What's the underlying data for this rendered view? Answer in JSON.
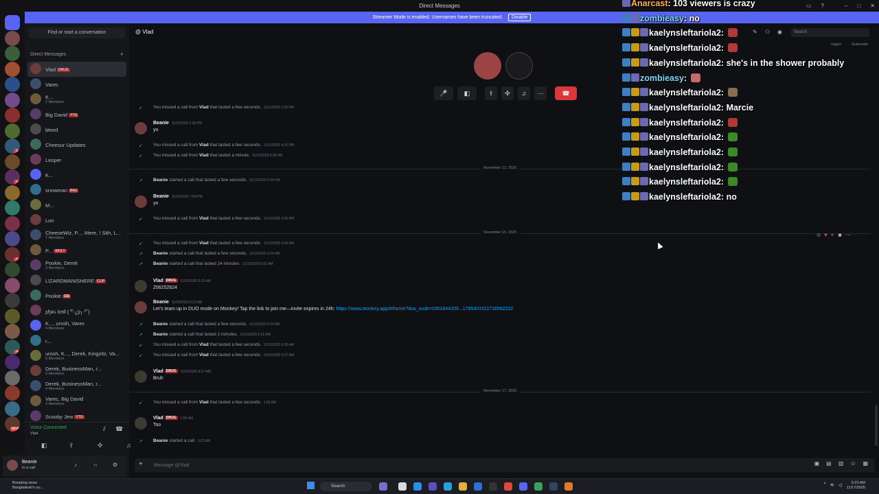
{
  "window": {
    "title": "Direct Messages"
  },
  "banner": {
    "text": "Streamer Mode is enabled. Usernames have been truncated.",
    "disable_label": "Disable"
  },
  "sidebar": {
    "search_label": "Find or start a conversation",
    "dm_header": "Direct Messages",
    "items": [
      {
        "name": "Vlad",
        "tag": "DRUG",
        "sub": ""
      },
      {
        "name": "Varec",
        "tag": "",
        "sub": ""
      },
      {
        "name": "K...",
        "tag": "",
        "sub": "2 Members"
      },
      {
        "name": "Big David",
        "tag": "YTG",
        "sub": ""
      },
      {
        "name": "bleed",
        "tag": "",
        "sub": ""
      },
      {
        "name": "Cheesur Updates",
        "tag": "",
        "sub": ""
      },
      {
        "name": "Leoper",
        "tag": "",
        "sub": ""
      },
      {
        "name": "K...",
        "tag": "",
        "sub": ""
      },
      {
        "name": "snowman",
        "tag": "BAU",
        "sub": ""
      },
      {
        "name": "M...",
        "tag": "",
        "sub": ""
      },
      {
        "name": "Lon",
        "tag": "",
        "sub": ""
      },
      {
        "name": "CheeseWiz, P..., Mere, ! Sith, L...",
        "tag": "",
        "sub": "7 Members"
      },
      {
        "name": "P...",
        "tag": "WOLY",
        "sub": ""
      },
      {
        "name": "Pookie, Derek",
        "tag": "",
        "sub": "3 Members"
      },
      {
        "name": "LIZARDMANISHERE",
        "tag": "CLIP",
        "sub": ""
      },
      {
        "name": "Pookie",
        "tag": "$$$",
        "sub": ""
      },
      {
        "name": "ʂђคเ ℓσฬ ( ͡°-╭͜ʖ╮-͡° )",
        "tag": "",
        "sub": ""
      },
      {
        "name": "K..., urosh, Varec",
        "tag": "",
        "sub": "4 Members"
      },
      {
        "name": "r...",
        "tag": "",
        "sub": ""
      },
      {
        "name": "urosh, K..., Derek, Kingzitz, Va...",
        "tag": "",
        "sub": "6 Members"
      },
      {
        "name": "Derek, BusinessMan, r...",
        "tag": "",
        "sub": "3 Members"
      },
      {
        "name": "Derek, BusinessMan, r...",
        "tag": "",
        "sub": "4 Members"
      },
      {
        "name": "Varec, Big David",
        "tag": "",
        "sub": "3 Members"
      },
      {
        "name": "Scooby Jew",
        "tag": "YTG",
        "sub": ""
      }
    ]
  },
  "rail": {
    "badges": [
      "1",
      "2",
      "3",
      "4",
      "NEW"
    ]
  },
  "voice": {
    "status": "Voice Connected",
    "channel": "Vlad"
  },
  "user": {
    "name": "Beanie",
    "status": "In a call"
  },
  "chat": {
    "channel": "Vlad",
    "composer_placeholder": "Message @Vlad",
    "rows": [
      {
        "kind": "call",
        "missed": true,
        "text_a": "You missed a call from",
        "who": "Vlad",
        "text_b": "that lasted a few seconds.",
        "ts": "11/11/2025 1:03 PM"
      },
      {
        "kind": "msg",
        "author": "Beanie",
        "ts": "11/11/2025 2:30 PM",
        "text": "yo"
      },
      {
        "kind": "call",
        "missed": true,
        "text_a": "You missed a call from",
        "who": "Vlad",
        "text_b": "that lasted a few seconds.",
        "ts": "11/11/2025 4:16 PM"
      },
      {
        "kind": "call",
        "missed": true,
        "text_a": "You missed a call from",
        "who": "Vlad",
        "text_b": "that lasted a minute.",
        "ts": "11/11/2025 9:38 PM"
      },
      {
        "kind": "divider",
        "label": "November 12, 2025"
      },
      {
        "kind": "call",
        "missed": false,
        "who": "Beanie",
        "text_b": "started a call that lasted a few seconds.",
        "ts": "11/12/2025 6:06 PM"
      },
      {
        "kind": "msg",
        "author": "Beanie",
        "ts": "11/12/2025 7:59 PM",
        "text": "yo"
      },
      {
        "kind": "call",
        "missed": true,
        "text_a": "You missed a call from",
        "who": "Vlad",
        "text_b": "that lasted a few seconds.",
        "ts": "11/12/2025 9:50 PM"
      },
      {
        "kind": "divider",
        "label": "November 15, 2025"
      },
      {
        "kind": "call",
        "missed": true,
        "text_a": "You missed a call from",
        "who": "Vlad",
        "text_b": "that lasted a few seconds.",
        "ts": "11/15/2025 6:03 AM"
      },
      {
        "kind": "call",
        "missed": false,
        "who": "Beanie",
        "text_b": "started a call that lasted a few seconds.",
        "ts": "11/15/2025 6:04 AM"
      },
      {
        "kind": "call",
        "missed": false,
        "who": "Beanie",
        "text_b": "started a call that lasted 24 minutes.",
        "ts": "11/15/2025 6:05 AM"
      },
      {
        "kind": "msg",
        "author": "Vlad",
        "tag": "DRUG",
        "ts": "11/15/2025 6:12 AM",
        "text": "256252624"
      },
      {
        "kind": "msg",
        "author": "Beanie",
        "ts": "11/15/2025 6:13 AM",
        "text": "Let's team up in DUO mode on Monkey! Tap the link to join me—invite expires in 24h:",
        "link": "https://www.monkey.app/#/home?duo_code=0351844200...1705301511716592222"
      },
      {
        "kind": "call",
        "missed": false,
        "who": "Beanie",
        "text_b": "started a call that lasted a few seconds.",
        "ts": "11/15/2025 6:24 AM"
      },
      {
        "kind": "call",
        "missed": false,
        "who": "Beanie",
        "text_b": "started a call that lasted 2 minutes.",
        "ts": "11/15/2025 6:25 AM"
      },
      {
        "kind": "call",
        "missed": true,
        "text_a": "You missed a call from",
        "who": "Vlad",
        "text_b": "that lasted a few seconds.",
        "ts": "11/15/2025 6:26 AM"
      },
      {
        "kind": "call",
        "missed": true,
        "text_a": "You missed a call from",
        "who": "Vlad",
        "text_b": "that lasted a few seconds.",
        "ts": "11/15/2025 6:27 AM"
      },
      {
        "kind": "msg",
        "author": "Vlad",
        "tag": "DRUG",
        "ts": "11/15/2025 6:27 AM",
        "text": "Bruh"
      },
      {
        "kind": "divider",
        "label": "November 17, 2025"
      },
      {
        "kind": "call",
        "missed": true,
        "text_a": "You missed a call from",
        "who": "Vlad",
        "text_b": "that lasted a few seconds.",
        "ts": "1:05 AM"
      },
      {
        "kind": "msg",
        "author": "Vlad",
        "tag": "DRUG",
        "ts": "1:05 AM",
        "text": "Too"
      },
      {
        "kind": "call",
        "missed": false,
        "who": "Beanie",
        "text_b": "started a call.",
        "ts": "5:22 AM"
      }
    ]
  },
  "tools": {
    "search_placeholder": "Search",
    "region": "region",
    "automatic": "Automatic"
  },
  "overlay": {
    "lines": [
      {
        "user": "Anarcast",
        "text": "103 viewers is crazy",
        "emote": ""
      },
      {
        "user": "zombieasy",
        "text": "no",
        "emote": ""
      },
      {
        "user": "kaelynsleftariola2",
        "text": "",
        "emote": "red"
      },
      {
        "user": "kaelynsleftariola2",
        "text": "",
        "emote": "red"
      },
      {
        "user": "kaelynsleftariola2",
        "text": "she's in the shower probably",
        "emote": ""
      },
      {
        "user": "zombieasy",
        "text": "",
        "emote": "pink"
      },
      {
        "user": "kaelynsleftariola2",
        "text": "",
        "emote": "face"
      },
      {
        "user": "kaelynsleftariola2",
        "text": "Marcie",
        "emote": ""
      },
      {
        "user": "kaelynsleftariola2",
        "text": "",
        "emote": "red"
      },
      {
        "user": "kaelynsleftariola2",
        "text": "",
        "emote": "w"
      },
      {
        "user": "kaelynsleftariola2",
        "text": "",
        "emote": "w"
      },
      {
        "user": "kaelynsleftariola2",
        "text": "",
        "emote": "w"
      },
      {
        "user": "kaelynsleftariola2",
        "text": "",
        "emote": "w"
      },
      {
        "user": "kaelynsleftariola2",
        "text": "no",
        "emote": ""
      }
    ]
  },
  "taskbar": {
    "news_title": "Breaking news",
    "news_sub": "Bangladesh's ou...",
    "search_label": "Search",
    "time": "5:23 AM",
    "date": "11/17/2025"
  }
}
